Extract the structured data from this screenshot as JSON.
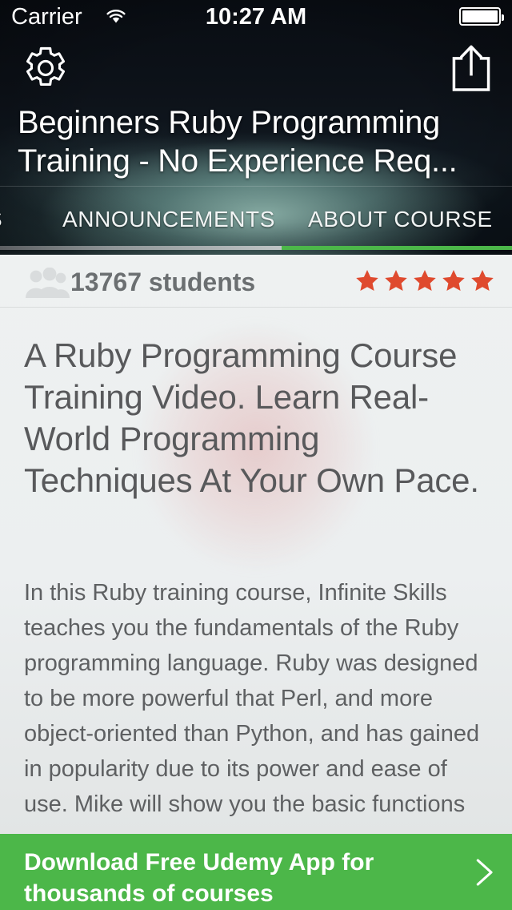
{
  "status_bar": {
    "carrier": "Carrier",
    "time": "10:27 AM",
    "wifi_icon": "wifi-icon",
    "battery_icon": "battery-full-icon"
  },
  "nav": {
    "settings_icon": "gear-icon",
    "share_icon": "share-icon"
  },
  "header": {
    "course_title": "Beginners Ruby Programming Training - No Experience Req..."
  },
  "tabs": {
    "items": [
      {
        "label": "S",
        "active": false
      },
      {
        "label": "ANNOUNCEMENTS",
        "active": false
      },
      {
        "label": "ABOUT COURSE",
        "active": true
      }
    ],
    "active_underline_color": "#4cb749"
  },
  "stats": {
    "people_icon": "people-group-icon",
    "students": "13767 students",
    "rating_stars": 5,
    "star_color": "#df4a2e"
  },
  "about": {
    "headline": "A Ruby Programming Course Training Video. Learn Real-World Programming Techniques At Your Own Pace.",
    "body": "In this Ruby training course, Infinite Skills teaches you the fundamentals of the Ruby programming language. Ruby was designed to be more powerful that Perl, and more object-oriented than Python, and has gained in popularity due to its power and ease of use. Mike will show you the basic functions"
  },
  "banner": {
    "text": "Download Free Udemy App for\nthousands of courses",
    "chevron_icon": "chevron-right-icon",
    "background_color": "#4cb749"
  }
}
